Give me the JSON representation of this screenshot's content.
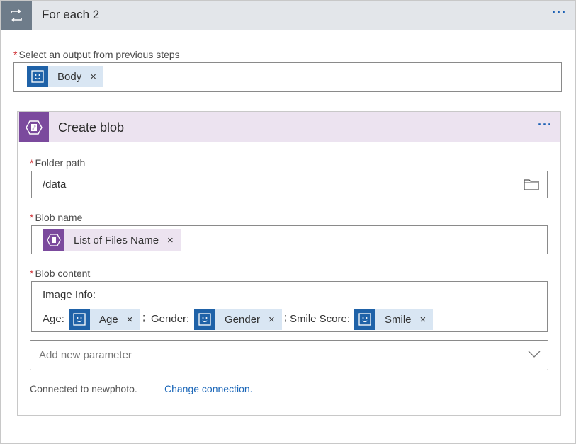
{
  "foreach": {
    "title": "For each 2",
    "more": "···",
    "select_label": "Select an output from previous steps",
    "select_token": "Body",
    "remove": "×"
  },
  "action": {
    "title": "Create blob",
    "more": "···",
    "folder_label": "Folder path",
    "folder_value": "/data",
    "blob_name_label": "Blob name",
    "blob_name_token": "List of Files Name",
    "blob_content_label": "Blob content",
    "content_line1": "Image Info:",
    "age_text": "Age:",
    "age_token": "Age",
    "sep1": ";",
    "gender_text": "Gender:",
    "gender_token": "Gender",
    "sep2": ";",
    "smile_text": "Smile Score:",
    "smile_token": "Smile",
    "add_param_placeholder": "Add new parameter",
    "connected_text": "Connected to newphoto.",
    "change_connection": "Change connection."
  },
  "required_mark": "*",
  "icons": {
    "loop": "loop-icon",
    "dynamic_content": "smiley-icon",
    "blob": "blob-storage-icon",
    "folder": "folder-icon",
    "chevron": "chevron-down-icon"
  },
  "colors": {
    "loop_icon_bg": "#6e7c8a",
    "blob_icon_bg": "#7b4a9d",
    "token_blue_bg": "#d9e6f3",
    "token_icon_blue": "#1f62a8",
    "link": "#1a66b8"
  }
}
